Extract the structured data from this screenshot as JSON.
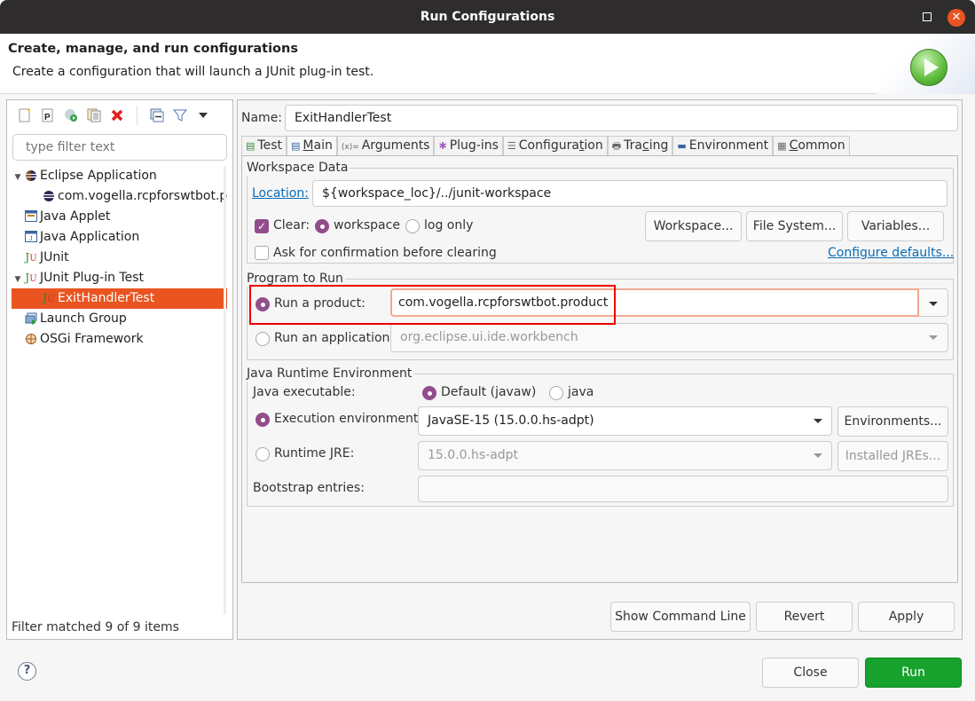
{
  "window": {
    "title": "Run Configurations",
    "maximize_icon": "maximize-icon",
    "close_icon": "close-icon"
  },
  "header": {
    "title": "Create, manage, and run configurations",
    "subtitle": "Create a configuration that will launch a JUnit plug-in test."
  },
  "toolbar": {
    "items": [
      "new-config-icon",
      "new-prototype-icon",
      "export-icon",
      "duplicate-icon",
      "delete-icon",
      "collapse-all-icon",
      "filter-icon",
      "view-menu-icon"
    ]
  },
  "filter": {
    "placeholder": "type filter text",
    "value": ""
  },
  "tree": {
    "items": [
      {
        "label": "Eclipse Application",
        "icon": "eclipse-icon",
        "expanded": true,
        "level": 0
      },
      {
        "label": "com.vogella.rcpforswtbot.p",
        "icon": "eclipse-icon",
        "level": 1
      },
      {
        "label": "Java Applet",
        "icon": "applet-icon",
        "level": 0
      },
      {
        "label": "Java Application",
        "icon": "java-app-icon",
        "level": 0
      },
      {
        "label": "JUnit",
        "icon": "junit-icon",
        "level": 0
      },
      {
        "label": "JUnit Plug-in Test",
        "icon": "junit-plugin-icon",
        "expanded": true,
        "level": 0
      },
      {
        "label": "ExitHandlerTest",
        "icon": "junit-plugin-icon",
        "level": 1,
        "selected": true
      },
      {
        "label": "Launch Group",
        "icon": "launch-group-icon",
        "level": 0
      },
      {
        "label": "OSGi Framework",
        "icon": "osgi-icon",
        "level": 0
      }
    ],
    "status": "Filter matched 9 of 9 items"
  },
  "config": {
    "name_label": "Name:",
    "name_value": "ExitHandlerTest",
    "tabs": [
      {
        "label": "Test",
        "mnemonic_prefix": "Test",
        "icon": "test-tab-icon"
      },
      {
        "pre": "",
        "u": "M",
        "post": "ain",
        "icon": "main-tab-icon",
        "active": true
      },
      {
        "label": "Arguments",
        "icon": "arguments-tab-icon"
      },
      {
        "label": "Plug-ins",
        "icon": "plugins-tab-icon"
      },
      {
        "pre": "Configura",
        "u": "t",
        "post": "ion",
        "icon": "configuration-tab-icon"
      },
      {
        "pre": "Tra",
        "u": "c",
        "post": "ing",
        "icon": "tracing-tab-icon"
      },
      {
        "label": "Environment",
        "icon": "environment-tab-icon"
      },
      {
        "pre": "",
        "u": "C",
        "post": "ommon",
        "icon": "common-tab-icon"
      }
    ]
  },
  "workspace": {
    "group_label": "Workspace Data",
    "location_label": "Location:",
    "location_value": "${workspace_loc}/../junit-workspace",
    "clear_label": "Clear:",
    "clear_checked": true,
    "workspace_radio": "workspace",
    "log_only_radio": "log only",
    "ask_label": "Ask for confirmation before clearing",
    "ask_checked": false,
    "buttons": {
      "workspace": "Workspace...",
      "file_system": "File System...",
      "variables": "Variables..."
    },
    "configure_defaults": "Configure defaults..."
  },
  "program": {
    "group_label": "Program to Run",
    "run_product_label": "Run a product:",
    "run_product_value": "com.vogella.rcpforswtbot.product",
    "run_app_label": "Run an application:",
    "run_app_value": "org.eclipse.ui.ide.workbench"
  },
  "jre": {
    "group_label": "Java Runtime Environment",
    "executable_label": "Java executable:",
    "default_javaw": "Default (javaw)",
    "java": "java",
    "exec_env_label": "Execution environment:",
    "exec_env_value": "JavaSE-15 (15.0.0.hs-adpt)",
    "environments_button": "Environments...",
    "runtime_jre_label": "Runtime JRE:",
    "runtime_jre_value": "15.0.0.hs-adpt",
    "installed_jres_button": "Installed JREs...",
    "bootstrap_label": "Bootstrap entries:",
    "bootstrap_value": ""
  },
  "actions": {
    "show_command_line": "Show Command Line",
    "revert": "Revert",
    "apply": "Apply",
    "close": "Close",
    "run": "Run"
  },
  "colors": {
    "accent": "#e95420",
    "radio": "#924d8b",
    "run": "#16a22c",
    "highlight_box": "#e00000"
  }
}
